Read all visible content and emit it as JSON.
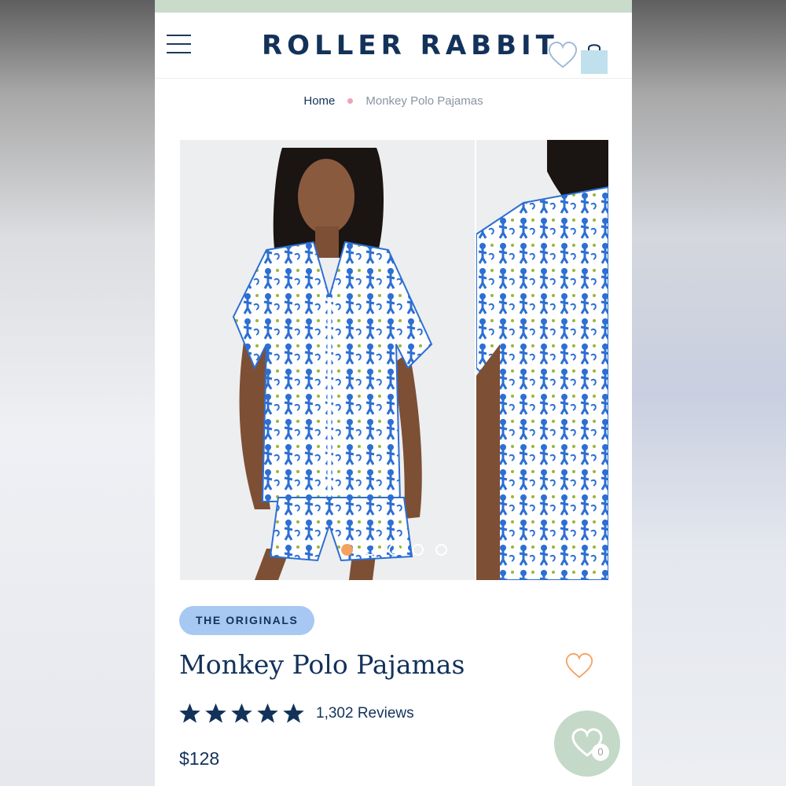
{
  "header": {
    "logo": "ROLLER RABBIT",
    "menu_icon": "hamburger-menu-icon",
    "wishlist_icon": "heart-outline-icon",
    "bag_icon": "shopping-bag-icon"
  },
  "breadcrumb": {
    "home": "Home",
    "current": "Monkey Polo Pajamas"
  },
  "gallery": {
    "images": [
      "product-photo-front",
      "product-photo-detail"
    ],
    "dots_total": 5,
    "active_dot": 1
  },
  "product": {
    "badge": "THE ORIGINALS",
    "title": "Monkey Polo Pajamas",
    "rating": 5,
    "reviews": "1,302 Reviews",
    "price": "$128"
  },
  "wishlist_fab": {
    "count": "0"
  },
  "colors": {
    "navy": "#13325a",
    "promo_green": "#c9dccb",
    "badge_blue": "#a7c8f2",
    "accent_orange": "#f4a261",
    "crumb_pink": "#f0a3b6"
  }
}
